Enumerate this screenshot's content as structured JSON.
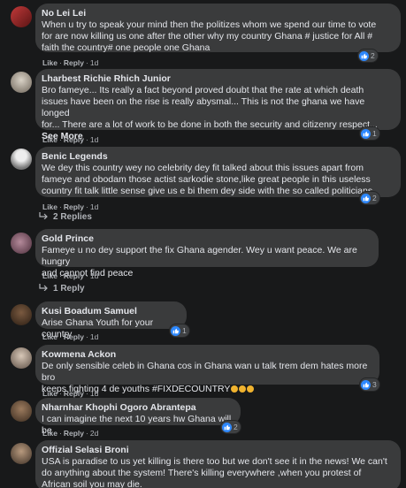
{
  "comments": [
    {
      "author": "No Lei Lei",
      "text": "When u try to speak your mind then the politizes whom we spend our time to vote\nfor are now killing us one after the other why my country Ghana # justice for All #\nfaith the country# one people one Ghana",
      "like": "Like",
      "reply": "Reply",
      "time": "1d",
      "reactions": "2"
    },
    {
      "author": "Lharbest Richie Rhich Junior",
      "text": "Bro fameye... Its really a fact beyond proved doubt that the rate at which death\nissues have been on the rise is really abysmal... This is not the ghana we have longed\nfor... There are a lot of work to be done in both the security and citizenry respect...",
      "see_more": "See More",
      "like": "Like",
      "reply": "Reply",
      "time": "1d",
      "reactions": "1"
    },
    {
      "author": "Benic Legends",
      "text": "We dey this country wey no celebrity dey fit talked about this issues apart from\nfameye and obodam those actist sarkodie stone,like great people in this useless\ncountry fit talk little sense give us e bi them dey side with the so called politicians",
      "like": "Like",
      "reply": "Reply",
      "time": "1d",
      "reactions": "2",
      "replies": "2 Replies"
    },
    {
      "author": "Gold Prince",
      "text": "Fameye u no dey support the fix Ghana agender. Wey u want peace. We are hungry\nand cannot find peace",
      "like": "Like",
      "reply": "Reply",
      "time": "1d",
      "replies": "1 Reply"
    },
    {
      "author": "Kusi Boadum Samuel",
      "text": "Arise Ghana Youth for your country",
      "like": "Like",
      "reply": "Reply",
      "time": "1d",
      "reactions": "1"
    },
    {
      "author": "Kowmena Ackon",
      "text": "De only sensible celeb in Ghana cos in Ghana wan u talk trem dem hates more bro\nkeeps fighting 4 de youths #FIXDECOUNTRY",
      "like": "Like",
      "reply": "Reply",
      "time": "1d",
      "reactions": "3"
    },
    {
      "author": "Nharnhar Khophi Ogoro Abrantepa",
      "text": "I can imagine the next 10 years hw Ghana will be",
      "like": "Like",
      "reply": "Reply",
      "time": "2d",
      "reactions": "2"
    },
    {
      "author": "Offizial Selasi Broni",
      "text": "USA is paradise to us yet killing is there too but we don't see it in the news! We can't\ndo anything about the system! There's killing everywhere ,when you protest of\nAfrican soil you may die."
    }
  ],
  "colors": {
    "background": "#18191a",
    "bubble": "#3a3b3c",
    "muted": "#b0b3b8",
    "like_blue": "#2d88ff"
  },
  "icons": {
    "reaction": "thumbs-up-icon",
    "reply_arrow": "reply-arrow-icon",
    "emoji": "fist-emoji-icon"
  }
}
